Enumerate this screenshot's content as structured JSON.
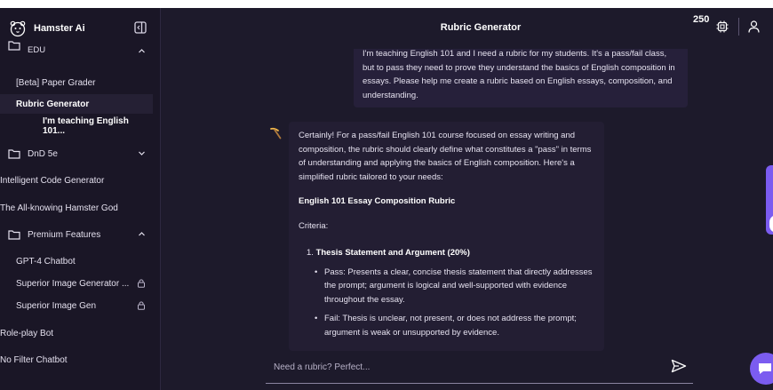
{
  "app": {
    "name": "Hamster Ai"
  },
  "header": {
    "title": "Rubric Generator",
    "credits": "250"
  },
  "sidebar": {
    "edu_folder": "EDU",
    "items": [
      {
        "label": "[Beta] Paper Grader"
      },
      {
        "label": "Rubric Generator"
      },
      {
        "label": "I'm teaching English 101..."
      }
    ],
    "dnd_folder": "DnD 5e",
    "flat_items": [
      {
        "label": "Intelligent Code Generator"
      },
      {
        "label": "The All-knowing Hamster God"
      }
    ],
    "premium_folder": "Premium Features",
    "premium_items": [
      {
        "label": "GPT-4 Chatbot"
      },
      {
        "label": "Superior Image Generator ..."
      },
      {
        "label": "Superior Image Gen"
      }
    ],
    "bottom_items": [
      {
        "label": "Role-play Bot"
      },
      {
        "label": "No Filter Chatbot"
      }
    ]
  },
  "chat": {
    "user_message": "I'm teaching English 101 and I need a rubric for my students. It's a pass/fail class, but to pass they need to prove they understand the basics of English composition in essays. Please help me create a rubric based on English essays, composition, and understanding.",
    "ai_intro": "Certainly! For a pass/fail English 101 course focused on essay writing and composition, the rubric should clearly define what constitutes a \"pass\" in terms of understanding and applying the basics of English composition. Here's a simplified rubric tailored to your needs:",
    "ai_heading": "English 101 Essay Composition Rubric",
    "ai_criteria": "Criteria:",
    "ai_item_number": "1.",
    "ai_item_title": "Thesis Statement and Argument (20%)",
    "ai_pass": "Pass: Presents a clear, concise thesis statement that directly addresses the prompt; argument is logical and well-supported with evidence throughout the essay.",
    "ai_fail": "Fail: Thesis is unclear, not present, or does not address the prompt; argument is weak or unsupported by evidence."
  },
  "input": {
    "placeholder": "Need a rubric? Perfect..."
  },
  "icons": {
    "logo": "hamster-logo-icon",
    "collapse": "sidebar-collapse-icon",
    "folder": "folder-icon",
    "chevron": "chevron-icon",
    "lock": "lock-icon",
    "credits": "credit-chip-icon",
    "user": "user-icon",
    "ai": "pickaxe-icon",
    "send": "send-icon",
    "chat_bubble": "chat-bubble-icon"
  },
  "colors": {
    "background": "#1d1a2b",
    "sidebar": "#1a1626",
    "accent": "#7b5cf0"
  }
}
